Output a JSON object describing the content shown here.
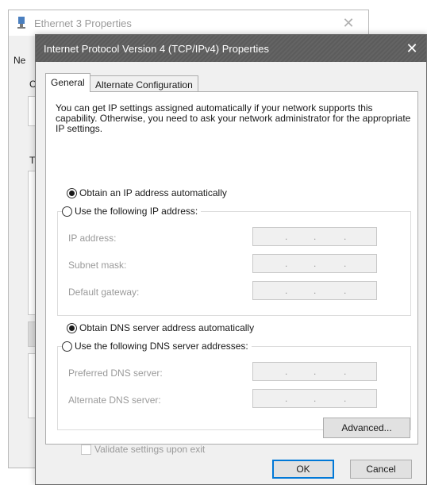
{
  "background_window": {
    "title": "Ethernet 3 Properties",
    "close_glyph": "✕",
    "tab_fragment": "Ne",
    "letter_c": "C",
    "letter_t": "T",
    "icon": "network-adapter-icon"
  },
  "dialog": {
    "title": "Internet Protocol Version 4 (TCP/IPv4) Properties",
    "close_glyph": "✕",
    "tabs": [
      {
        "label": "General",
        "active": true
      },
      {
        "label": "Alternate Configuration",
        "active": false
      }
    ],
    "description": "You can get IP settings assigned automatically if your network supports this capability. Otherwise, you need to ask your network administrator for the appropriate IP settings.",
    "ip_section": {
      "auto_label": "Obtain an IP address automatically",
      "auto_selected": true,
      "manual_label": "Use the following IP address:",
      "manual_selected": false,
      "fields": [
        {
          "label": "IP address:",
          "value": ". . ."
        },
        {
          "label": "Subnet mask:",
          "value": ". . ."
        },
        {
          "label": "Default gateway:",
          "value": ". . ."
        }
      ]
    },
    "dns_section": {
      "auto_label": "Obtain DNS server address automatically",
      "auto_selected": true,
      "manual_label": "Use the following DNS server addresses:",
      "manual_selected": false,
      "fields": [
        {
          "label": "Preferred DNS server:",
          "value": ". . ."
        },
        {
          "label": "Alternate DNS server:",
          "value": ". . ."
        }
      ]
    },
    "validate_label": "Validate settings upon exit",
    "validate_checked": false,
    "advanced_label": "Advanced...",
    "ok_label": "OK",
    "cancel_label": "Cancel",
    "colors": {
      "titlebar": "#5f5f5f",
      "default_button_border": "#0078d7",
      "disabled_text": "#9a9a9a"
    }
  }
}
